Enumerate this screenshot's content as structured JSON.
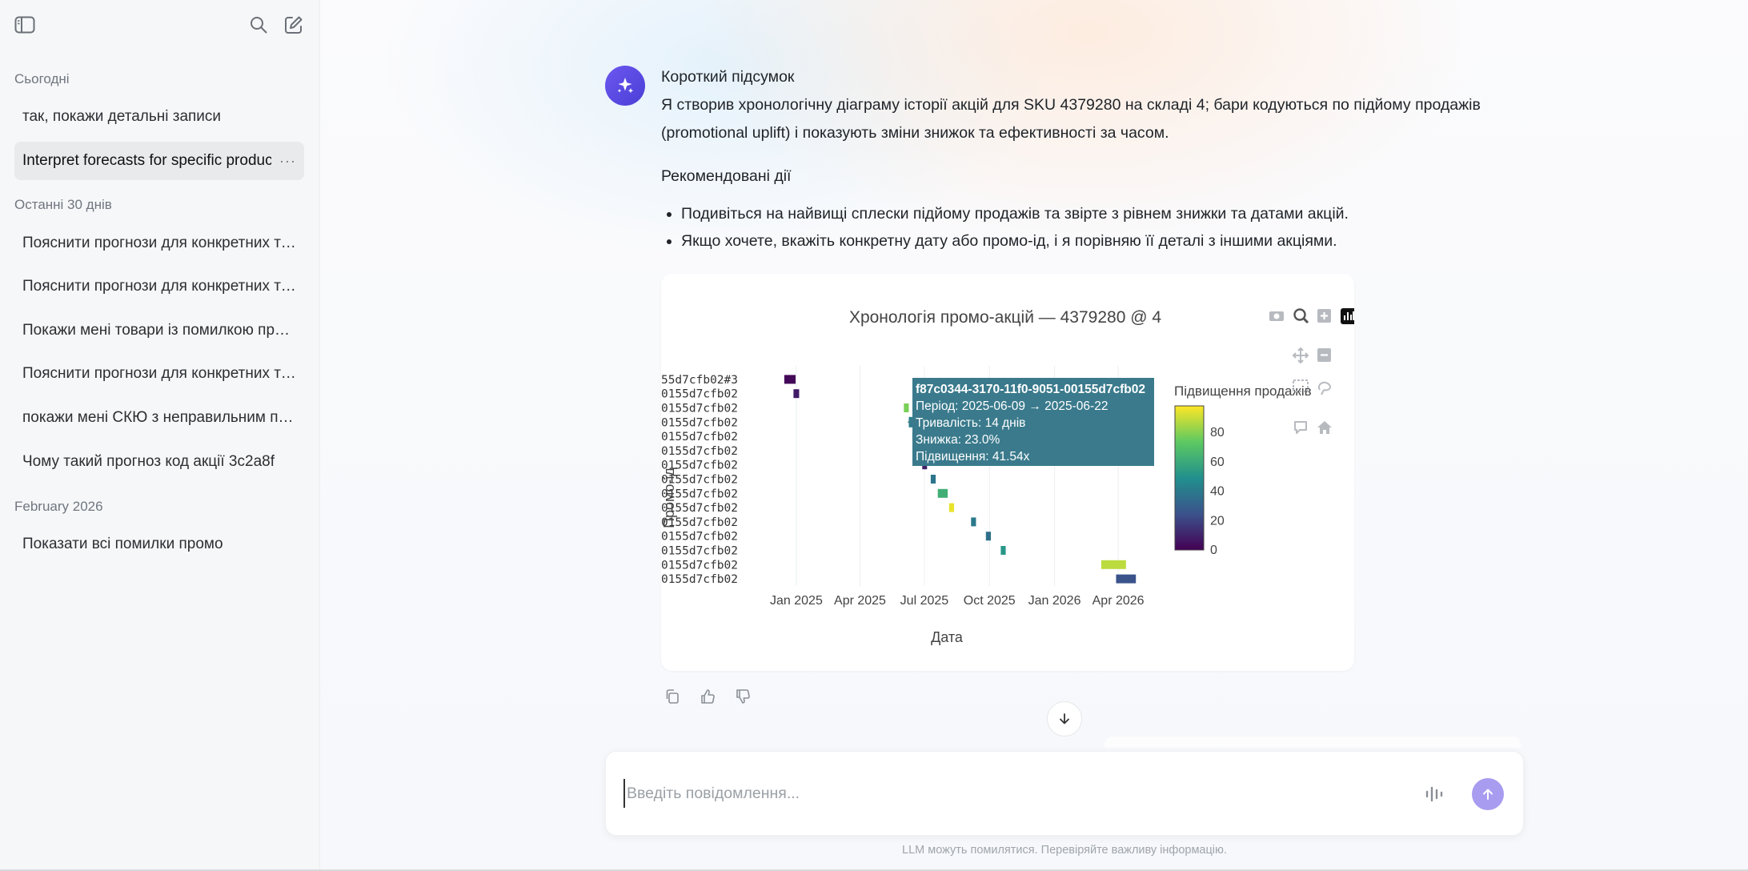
{
  "sidebar": {
    "sections": [
      {
        "label": "Сьогодні",
        "items": [
          {
            "label": "так, покажи детальні записи"
          },
          {
            "label": "Interpret forecasts for specific products",
            "active": true,
            "more": "···"
          }
        ]
      },
      {
        "label": "Останні 30 днів",
        "items": [
          {
            "label": "Пояснити прогнози для конкретних товарів"
          },
          {
            "label": "Пояснити прогнози для конкретних товарів"
          },
          {
            "label": "Покажи мені товари із помилкою прогнозу"
          },
          {
            "label": "Пояснити прогнози для конкретних товарів"
          },
          {
            "label": "покажи мені СКЮ з неправильним прогнозом"
          },
          {
            "label": "Чому такий прогноз код акції 3c2a8f"
          }
        ]
      },
      {
        "label": "February 2026",
        "items": [
          {
            "label": "Показати всі помилки промо"
          }
        ]
      }
    ],
    "icons": [
      "sidebar-toggle-icon",
      "search-icon",
      "new-chat-icon"
    ]
  },
  "message": {
    "summary_title": "Короткий підсумок",
    "summary_line1": "Я створив хронологічну діаграму історії акцій для SKU 4379280 на складі 4; бари кодуються по підйому продажів",
    "summary_line2": "(promotional uplift) і показують зміни знижок та ефективності за часом.",
    "actions_title": "Рекомендовані дії",
    "bullets": [
      "Подивіться на найвищі сплески підйому продажів та звірте з рівнем знижки та датами акцій.",
      "Якщо хочете, вкажіть конкретну дату або промо-ід, і я порівняю її деталі з іншими акціями."
    ]
  },
  "chart_data": {
    "type": "timeline",
    "title": "Хронологія промо-акцій — 4379280 @ 4",
    "xlabel": "Дата",
    "ylabel": "Промо-ід",
    "x_ticks": [
      "Jan 2025",
      "Apr 2025",
      "Jul 2025",
      "Oct 2025",
      "Jan 2026",
      "Apr 2026"
    ],
    "x_range": [
      "2024-10-15",
      "2026-05-15"
    ],
    "colorbar": {
      "title": "Підвищення продажів",
      "ticks": [
        0,
        20,
        40,
        60,
        80
      ],
      "range": [
        0,
        98
      ],
      "colorscale": "viridis"
    },
    "y_labels": [
      "55d7cfb02#3",
      "0155d7cfb02",
      "0155d7cfb02",
      "0155d7cfb02",
      "0155d7cfb02",
      "0155d7cfb02",
      "0155d7cfb02",
      "0155d7cfb02",
      "0155d7cfb02",
      "0155d7cfb02",
      "0155d7cfb02",
      "0155d7cfb02",
      "0155d7cfb02",
      "0155d7cfb02",
      "0155d7cfb02"
    ],
    "bars": [
      {
        "row": 0,
        "start": "2024-12-15",
        "end": "2024-12-31",
        "uplift": 2
      },
      {
        "row": 1,
        "start": "2024-12-28",
        "end": "2025-01-05",
        "uplift": 8
      },
      {
        "row": 2,
        "start": "2025-06-02",
        "end": "2025-06-09",
        "uplift": 78
      },
      {
        "row": 3,
        "start": "2025-06-09",
        "end": "2025-06-22",
        "uplift": 41.54
      },
      {
        "row": 4,
        "start": "2025-06-14",
        "end": "2025-06-21",
        "uplift": 50
      },
      {
        "row": 5,
        "start": "2025-06-19",
        "end": "2025-06-26",
        "uplift": 55
      },
      {
        "row": 6,
        "start": "2025-06-28",
        "end": "2025-07-04",
        "uplift": 10
      },
      {
        "row": 7,
        "start": "2025-07-10",
        "end": "2025-07-17",
        "uplift": 38
      },
      {
        "row": 8,
        "start": "2025-07-20",
        "end": "2025-08-03",
        "uplift": 62
      },
      {
        "row": 9,
        "start": "2025-08-05",
        "end": "2025-08-12",
        "uplift": 95
      },
      {
        "row": 10,
        "start": "2025-09-05",
        "end": "2025-09-12",
        "uplift": 40
      },
      {
        "row": 11,
        "start": "2025-09-26",
        "end": "2025-10-03",
        "uplift": 36
      },
      {
        "row": 12,
        "start": "2025-10-17",
        "end": "2025-10-24",
        "uplift": 52
      },
      {
        "row": 13,
        "start": "2026-03-08",
        "end": "2026-04-12",
        "uplift": 88
      },
      {
        "row": 14,
        "start": "2026-03-29",
        "end": "2026-04-26",
        "uplift": 25
      }
    ],
    "tooltip": {
      "title": "f87c0344-3170-11f0-9051-00155d7cfb02",
      "lines": [
        "Період: 2025-06-09 → 2025-06-22",
        "Тривалість: 14 днів",
        "Знижка: 23.0%",
        "Підвищення: 41.54x"
      ],
      "row": 3,
      "color": "#3a7a8c"
    },
    "modebar_icons": [
      "camera-icon",
      "zoom-icon",
      "zoom-in-icon",
      "plotly-logo-icon",
      "pan-icon",
      "zoom-out-icon",
      "box-select-icon",
      "lasso-icon",
      "hover-compare-icon",
      "reset-home-icon"
    ]
  },
  "feedback": {
    "icons": [
      "copy-icon",
      "thumbs-up-icon",
      "thumbs-down-icon"
    ]
  },
  "composer": {
    "placeholder": "Введіть повідомлення..."
  },
  "disclaimer": "LLM можуть помилятися. Перевіряйте важливу інформацію.",
  "colors": {
    "accent": "#5b4ae3",
    "send": "#a79cf0",
    "sidebar_bg": "#f6f7f8"
  }
}
